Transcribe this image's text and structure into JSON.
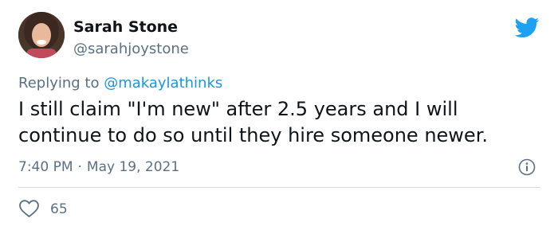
{
  "author": {
    "display_name": "Sarah Stone",
    "handle": "@sarahjoystone"
  },
  "reply": {
    "prefix": "Replying to ",
    "mention": "@makaylathinks"
  },
  "tweet": {
    "text": "I still claim \"I'm new\" after 2.5 years and I will continue to do so until they hire someone newer."
  },
  "meta": {
    "time": "7:40 PM",
    "separator": "·",
    "date": "May 19, 2021"
  },
  "actions": {
    "like_count": "65"
  },
  "colors": {
    "twitter_blue": "#1DA1F2",
    "mention_blue": "#1B95E0",
    "secondary_text": "#5B7083",
    "primary_text": "#0F1419"
  },
  "icons": {
    "brand": "twitter-bird-icon",
    "info": "info-icon",
    "like": "heart-icon"
  }
}
